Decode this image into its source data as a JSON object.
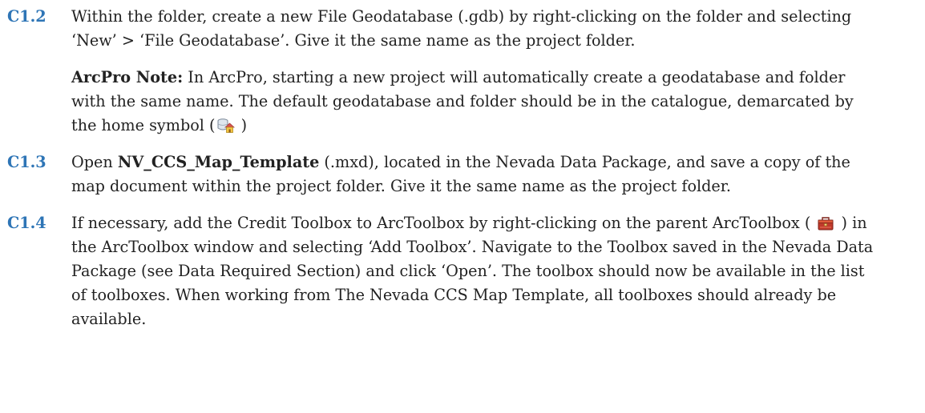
{
  "steps": [
    {
      "number": "C1.2",
      "text": "Within the folder, create a new File Geodatabase (.gdb) by right-clicking on the folder and selecting ‘New’ > ‘File Geodatabase’. Give it the same name as the project folder.",
      "note": {
        "label": "ArcPro Note:",
        "text_before_icon": " In ArcPro, starting a new project will automatically create a geodatabase and folder with the same name. The default geodatabase and folder should be in the catalogue, demarcated by the home symbol (",
        "icon": "home-geodatabase-icon",
        "text_after_icon": " )"
      }
    },
    {
      "number": "C1.3",
      "text_before_bold": "Open ",
      "bold": "NV_CCS_Map_Template",
      "text_after_bold": " (.mxd), located in the Nevada Data Package, and save a copy of the map document within the project folder. Give it the same name as the project folder."
    },
    {
      "number": "C1.4",
      "text_before_icon": "If necessary, add the Credit Toolbox to ArcToolbox by right-clicking on the parent ArcToolbox ( ",
      "icon": "arctoolbox-icon",
      "text_after_icon": " ) in the ArcToolbox window and selecting ‘Add Toolbox’. Navigate to the Toolbox saved in the Nevada Data Package (see Data Required Section) and click ‘Open’. The toolbox should now be available in the list of toolboxes. When working from The Nevada CCS Map Template, all toolboxes should already be available."
    }
  ],
  "colors": {
    "step_number": "#2e75b6",
    "text": "#222222"
  }
}
